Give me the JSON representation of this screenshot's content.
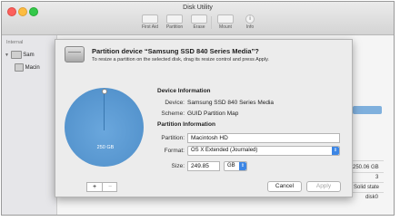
{
  "window": {
    "title": "Disk Utility"
  },
  "toolbar": [
    {
      "label": "First Aid",
      "icon": "first-aid-icon"
    },
    {
      "label": "Partition",
      "icon": "partition-icon"
    },
    {
      "label": "Erase",
      "icon": "erase-icon"
    },
    {
      "label": "Mount",
      "icon": "mount-icon"
    },
    {
      "label": "Info",
      "icon": "info-icon"
    }
  ],
  "sidebar": {
    "section_label": "Internal",
    "items": [
      {
        "label": "Sam",
        "icon": "disk-icon"
      },
      {
        "label": "Macin",
        "icon": "volume-icon"
      }
    ]
  },
  "background_values": {
    "capacity": "250.06 GB",
    "count": "3",
    "type": "Solid state",
    "device": "disk0"
  },
  "sheet": {
    "title": "Partition device “Samsung SSD 840 Series Media”?",
    "subtitle": "To resize a partition on the selected disk, drag its resize control and press Apply.",
    "pie_label": "250 GB",
    "device_info": {
      "header": "Device Information",
      "device_label": "Device:",
      "device_value": "Samsung SSD 840 Series Media",
      "scheme_label": "Scheme:",
      "scheme_value": "GUID Partition Map"
    },
    "partition_info": {
      "header": "Partition Information",
      "partition_label": "Partition:",
      "partition_value": "Macintosh HD",
      "format_label": "Format:",
      "format_value": "OS X Extended (Journaled)",
      "size_label": "Size:",
      "size_value": "249.85",
      "size_unit": "GB"
    },
    "buttons": {
      "add": "+",
      "remove": "−",
      "cancel": "Cancel",
      "apply": "Apply"
    }
  },
  "colors": {
    "pie": "#4c8cc7",
    "accent": "#3c86e5"
  }
}
